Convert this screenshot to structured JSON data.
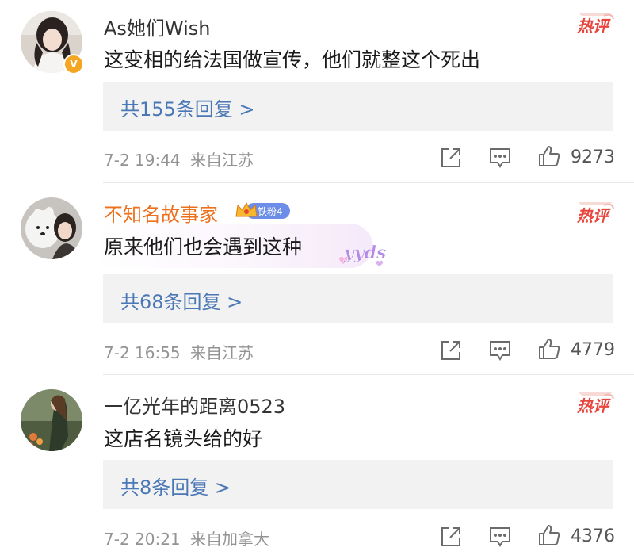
{
  "comments": [
    {
      "username": "As她们Wish",
      "content": "这变相的给法国做宣传，他们就整这个死出",
      "replies": "共155条回复 >",
      "date": "7-2 19:44",
      "location": "来自江苏",
      "likes": "9273",
      "hot_label": "热评"
    },
    {
      "username": "不知名故事家",
      "fan_badge": "铁粉4",
      "content": "原来他们也会遇到这种",
      "sticker_text": "yyds",
      "replies": "共68条回复 >",
      "date": "7-2 16:55",
      "location": "来自江苏",
      "likes": "4779",
      "hot_label": "热评"
    },
    {
      "username": "一亿光年的距离0523",
      "content": "这店名镜头给的好",
      "replies": "共8条回复 >",
      "date": "7-2 20:21",
      "location": "来自加拿大",
      "likes": "4376",
      "hot_label": "热评"
    }
  ],
  "colors": {
    "reply_link": "#4a77b5",
    "username_vip": "#ee6f1c",
    "hot_badge": "#e8453c",
    "meta": "#939393"
  },
  "icons": [
    "verified-icon",
    "hot-comment-icon",
    "share-icon",
    "comment-icon",
    "like-icon",
    "crown-icon"
  ]
}
